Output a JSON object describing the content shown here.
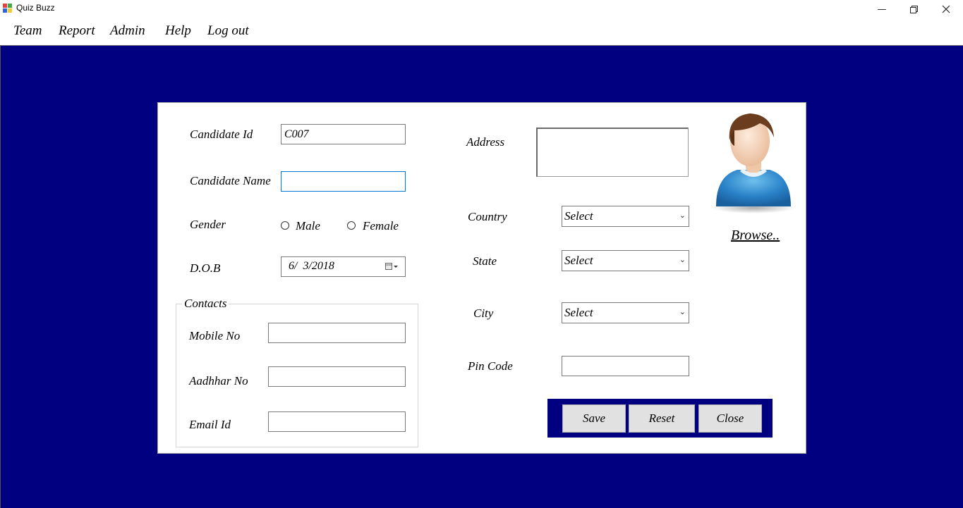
{
  "window": {
    "title": "Quiz Buzz",
    "minimize_icon": "minimize-icon",
    "maximize_icon": "restore-icon",
    "close_icon": "close-icon"
  },
  "menu": {
    "items": [
      "Team",
      "Report",
      "Admin",
      "Help",
      "Log out"
    ]
  },
  "form": {
    "candidate_id": {
      "label": "Candidate Id",
      "value": "C007"
    },
    "candidate_name": {
      "label": "Candidate Name",
      "value": ""
    },
    "gender": {
      "label": "Gender",
      "options": [
        "Male",
        "Female"
      ]
    },
    "dob": {
      "label": "D.O.B",
      "value": "6/  3/2018"
    },
    "contacts": {
      "title": "Contacts",
      "mobile": {
        "label": "Mobile No",
        "value": ""
      },
      "aadhhar": {
        "label": "Aadhhar No",
        "value": ""
      },
      "email": {
        "label": "Email Id",
        "value": ""
      }
    },
    "address": {
      "label": "Address",
      "value": ""
    },
    "country": {
      "label": "Country",
      "value": "Select"
    },
    "state": {
      "label": "State",
      "value": "Select"
    },
    "city": {
      "label": "City",
      "value": "Select"
    },
    "pin_code": {
      "label": "Pin Code",
      "value": ""
    },
    "browse_label": "Browse..",
    "buttons": {
      "save": "Save",
      "reset": "Reset",
      "close": "Close"
    }
  },
  "colors": {
    "background": "#000080",
    "panel": "#ffffff",
    "button": "#e1e1e1"
  }
}
